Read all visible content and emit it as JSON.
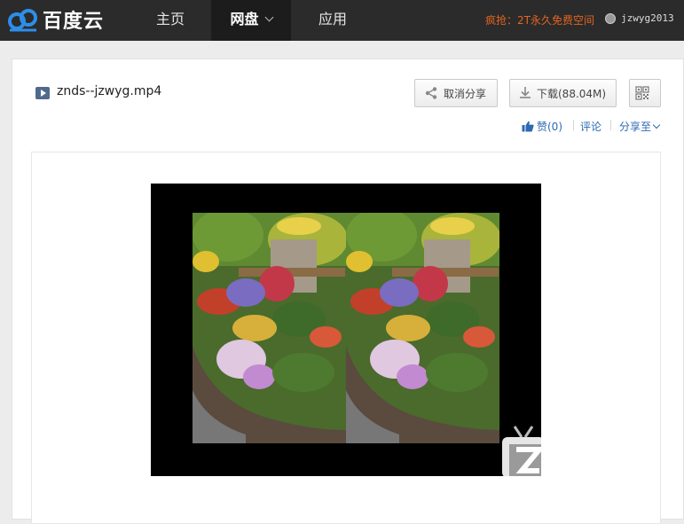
{
  "header": {
    "logo_text": "百度云",
    "nav": [
      {
        "label": "主页"
      },
      {
        "label": "网盘"
      },
      {
        "label": "应用"
      }
    ],
    "promo": "疯抢：2T永久免费空间",
    "username": "jzwyg2013"
  },
  "file": {
    "name": "znds--jzwyg.mp4"
  },
  "actions": {
    "unshare_label": "取消分享",
    "download_label": "下载(88.04M)"
  },
  "social": {
    "like_label": "赞(0)",
    "comment_label": "评论",
    "share_label": "分享至"
  },
  "colors": {
    "topbar": "#2b2b2b",
    "promo": "#e3641f",
    "link": "#2d6ab2"
  }
}
